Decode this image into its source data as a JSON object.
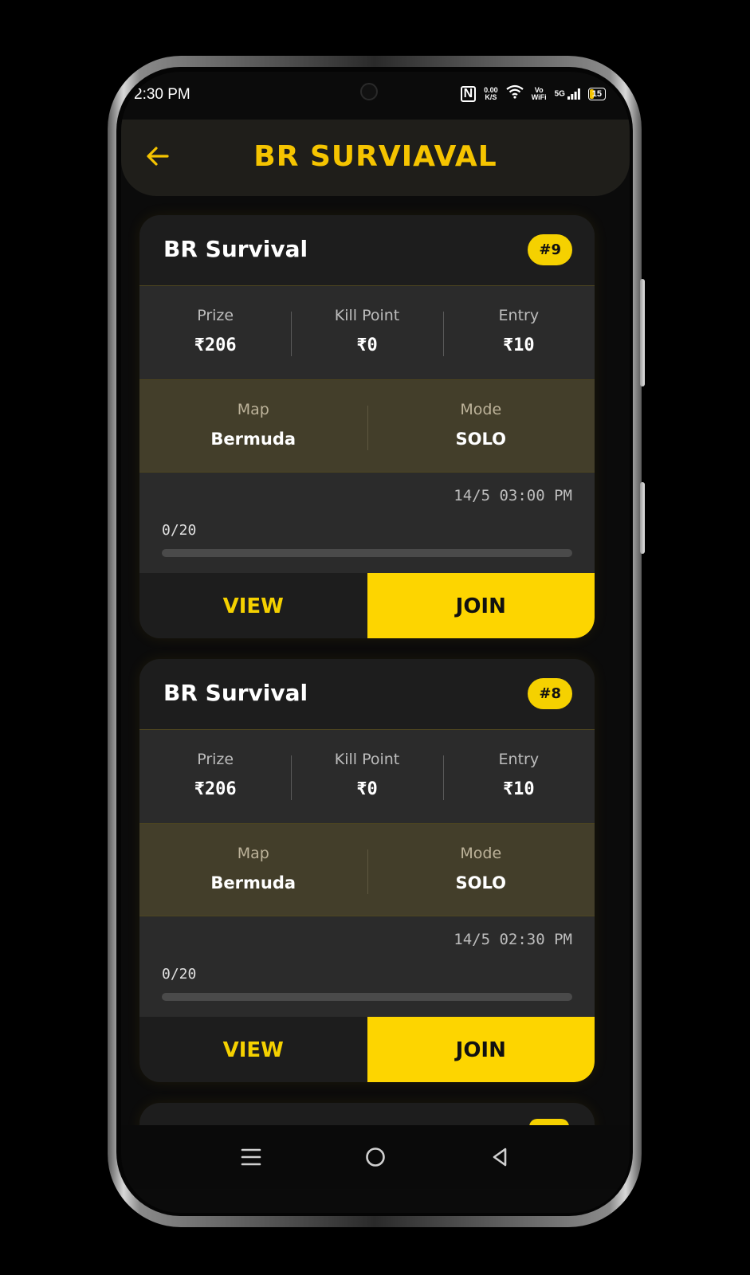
{
  "status_bar": {
    "time": "2:30 PM",
    "nfc": "N",
    "net_speed": "0.00",
    "net_unit": "K/S",
    "wifi_icon": "wifi-icon",
    "vowifi_top": "Vo",
    "vowifi_bottom": "WiFi",
    "signal": "5G",
    "battery": "15"
  },
  "header": {
    "back_icon": "arrow-left-icon",
    "title": "BR SURVIAVAL"
  },
  "accent_color": "#f5d100",
  "cards": [
    {
      "title": "BR Survival",
      "badge": "#9",
      "prize_label": "Prize",
      "prize": "₹206",
      "kill_label": "Kill Point",
      "kill": "₹0",
      "entry_label": "Entry",
      "entry": "₹10",
      "map_label": "Map",
      "map": "Bermuda",
      "mode_label": "Mode",
      "mode": "SOLO",
      "datetime": "14/5 03:00 PM",
      "slots": "0/20",
      "fill_fraction": 0,
      "view_label": "VIEW",
      "join_label": "JOIN"
    },
    {
      "title": "BR Survival",
      "badge": "#8",
      "prize_label": "Prize",
      "prize": "₹206",
      "kill_label": "Kill Point",
      "kill": "₹0",
      "entry_label": "Entry",
      "entry": "₹10",
      "map_label": "Map",
      "map": "Bermuda",
      "mode_label": "Mode",
      "mode": "SOLO",
      "datetime": "14/5 02:30 PM",
      "slots": "0/20",
      "fill_fraction": 0,
      "view_label": "VIEW",
      "join_label": "JOIN"
    }
  ],
  "nav": {
    "menu_icon": "menu-icon",
    "home_icon": "home-circle-icon",
    "back_icon": "back-triangle-icon"
  }
}
